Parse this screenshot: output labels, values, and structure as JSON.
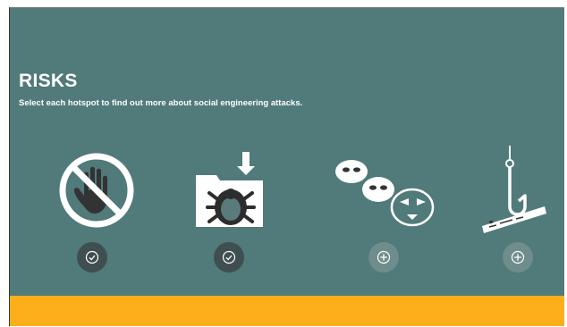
{
  "header": {
    "title": "RISKS",
    "instructions": "Select each hotspot to find out more about social engineering attacks."
  },
  "hotspots": [
    {
      "icon": "no-hand-icon",
      "state": "visited",
      "button_icon": "check-icon"
    },
    {
      "icon": "folder-bug-download-icon",
      "state": "visited",
      "button_icon": "check-icon"
    },
    {
      "icon": "masks-icon",
      "state": "unvisited",
      "button_icon": "plus-icon"
    },
    {
      "icon": "phishing-hook-icon",
      "state": "unvisited",
      "button_icon": "plus-icon"
    }
  ],
  "colors": {
    "panel": "#517a7a",
    "footer": "#fcaf1b",
    "visited_button": "#3f4f4f",
    "unvisited_button": "#6f8d8c",
    "text": "#ffffff"
  }
}
